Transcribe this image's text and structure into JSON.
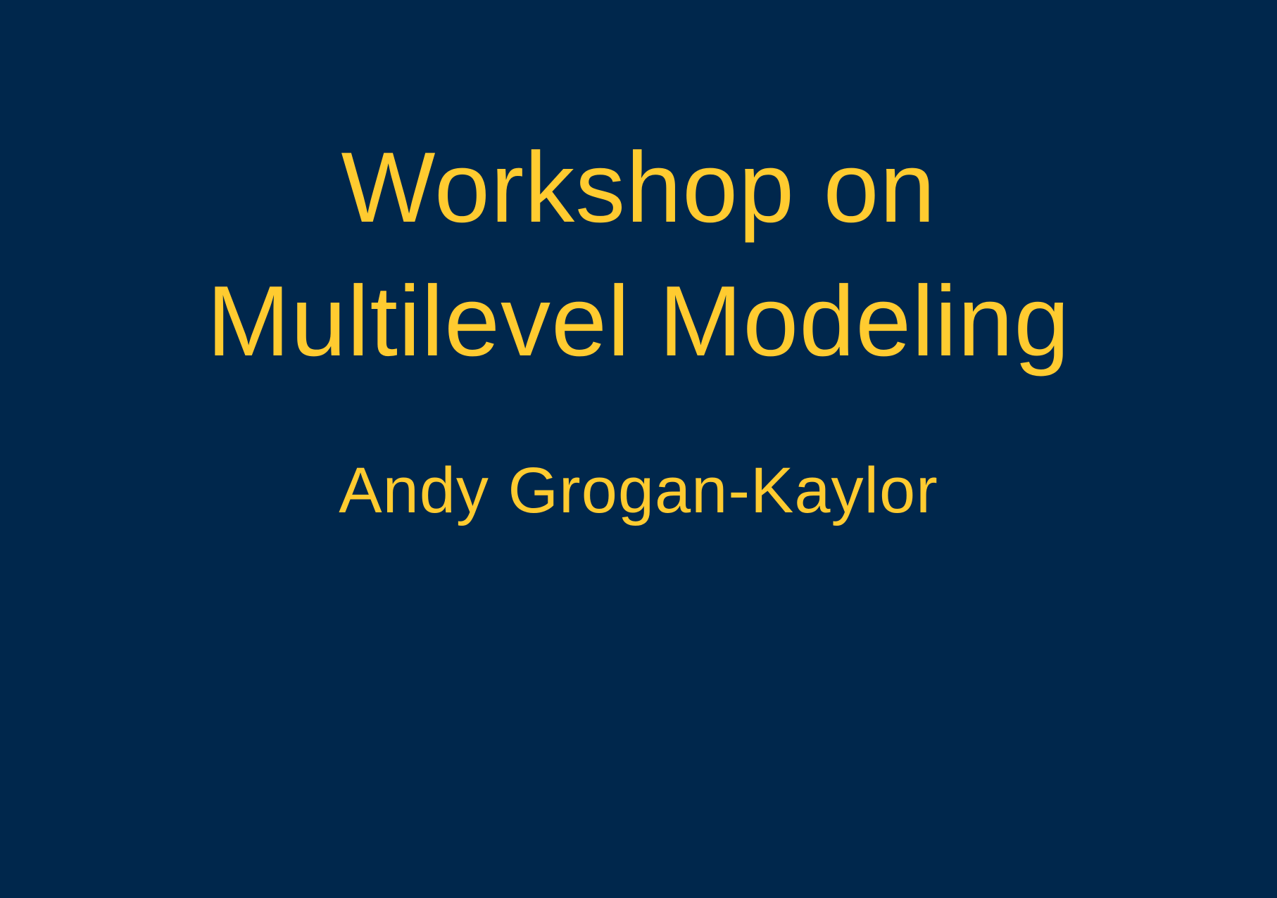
{
  "slide": {
    "title_line1": "Workshop on",
    "title_line2": "Multilevel Modeling",
    "author": "Andy Grogan-Kaylor",
    "background_color": "#00274C",
    "text_color": "#FFCB30"
  }
}
